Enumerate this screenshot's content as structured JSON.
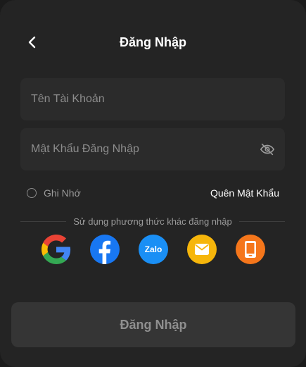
{
  "header": {
    "title": "Đăng Nhập",
    "back_icon": "chevron-left-icon"
  },
  "form": {
    "username_placeholder": "Tên Tài Khoản",
    "username_value": "",
    "password_placeholder": "Mật Khẩu Đăng Nhập",
    "password_value": "",
    "password_toggle_icon": "eye-off-icon",
    "remember_label": "Ghi Nhớ",
    "remember_checked": false,
    "forgot_label": "Quên Mật Khẩu"
  },
  "social": {
    "divider_text": "Sử dụng phương thức khác đăng nhập",
    "providers": [
      {
        "name": "google",
        "icon": "google-icon"
      },
      {
        "name": "facebook",
        "icon": "facebook-icon",
        "color": "#1877f2"
      },
      {
        "name": "zalo",
        "icon": "zalo-icon",
        "label": "Zalo",
        "color": "#1a8ff5"
      },
      {
        "name": "email",
        "icon": "email-icon",
        "color": "#f6b60b"
      },
      {
        "name": "phone",
        "icon": "phone-icon",
        "color": "#f5761b"
      }
    ]
  },
  "submit": {
    "label": "Đăng Nhập"
  },
  "colors": {
    "background": "#242424",
    "field": "#2b2b2b",
    "button": "#353535"
  }
}
